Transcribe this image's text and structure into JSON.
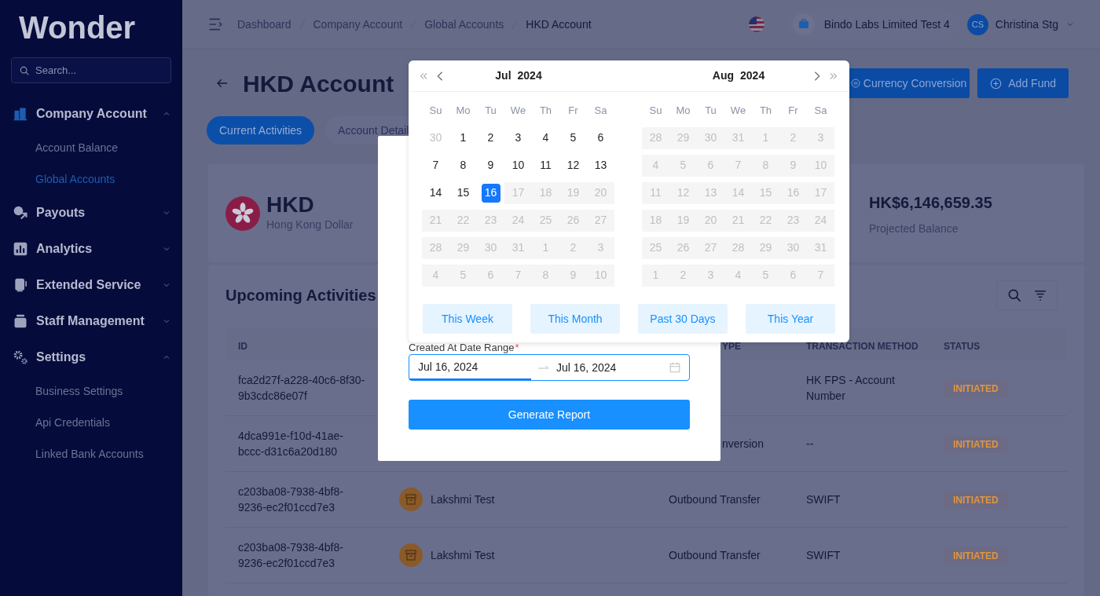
{
  "sidebar": {
    "logo": "Wonder",
    "search_placeholder": "Search...",
    "items": [
      {
        "label": "Company Account",
        "kind": "building",
        "expanded": true,
        "children": [
          {
            "label": "Account Balance",
            "selected": false
          },
          {
            "label": "Global Accounts",
            "selected": true
          }
        ]
      },
      {
        "label": "Payouts",
        "kind": "payout",
        "expanded": false
      },
      {
        "label": "Analytics",
        "kind": "chart",
        "expanded": false
      },
      {
        "label": "Extended Service",
        "kind": "service",
        "expanded": false
      },
      {
        "label": "Staff Management",
        "kind": "staff",
        "expanded": false
      },
      {
        "label": "Settings",
        "kind": "gear",
        "expanded": true,
        "children": [
          {
            "label": "Business Settings",
            "selected": false
          },
          {
            "label": "Api Credentials",
            "selected": false
          },
          {
            "label": "Linked Bank Accounts",
            "selected": false
          }
        ]
      }
    ]
  },
  "header": {
    "breadcrumbs": [
      {
        "label": "Dashboard",
        "selected": false
      },
      {
        "label": "Company Account",
        "selected": false
      },
      {
        "label": "Global Accounts",
        "selected": false
      },
      {
        "label": "HKD Account",
        "selected": true
      }
    ],
    "company": "Bindo Labs Limited Test 4",
    "user_initials": "CS",
    "user_name": "Christina Stg"
  },
  "page": {
    "title": "HKD Account",
    "actions": [
      {
        "label": "Currency Conversion",
        "kind": "convert"
      },
      {
        "label": "Add Fund",
        "kind": "add"
      }
    ],
    "tabs": [
      {
        "label": "Current Activities",
        "selected": true
      },
      {
        "label": "Account Detail",
        "selected": false
      }
    ]
  },
  "balance": {
    "code": "HKD",
    "name": "Hong Kong Dollar",
    "projected": "HK$6,146,659.35",
    "projected_label": "Projected Balance"
  },
  "activities": {
    "title": "Upcoming Activities",
    "columns": [
      {
        "label": "ID",
        "kind": "id",
        "partly_hidden": false
      },
      {
        "label": "YPE",
        "kind": "type",
        "partly_hidden": true
      },
      {
        "label": "TRANSACTION METHOD",
        "kind": "method",
        "partly_hidden": false
      },
      {
        "label": "STATUS",
        "kind": "status",
        "partly_hidden": false
      }
    ],
    "rows": [
      {
        "id": "fca2d27f-a228-40c6-8f30-9b3cdc86e07f",
        "method": "HK FPS - Account Number",
        "status": "INITIATED"
      },
      {
        "id": "4dca991e-f10d-41ae-bccc-d31c6a20d180",
        "type": "nversion",
        "type_partly_hidden": true,
        "method": "--",
        "status": "INITIATED"
      },
      {
        "id": "c203ba08-7938-4bf8-9236-ec2f01ccd7e3",
        "counterparty": "Lakshmi Test",
        "type": "Outbound Transfer",
        "type_partly_hidden": false,
        "method": "SWIFT",
        "status": "INITIATED"
      },
      {
        "id": "c203ba08-7938-4bf8-9236-ec2f01ccd7e3",
        "counterparty": "Lakshmi Test",
        "type": "Outbound Transfer",
        "type_partly_hidden": false,
        "method": "SWIFT",
        "status": "INITIATED"
      }
    ]
  },
  "report_modal": {
    "label": "Created At Date Range",
    "required_mark": "*",
    "start": "Jul 16, 2024",
    "start_active": true,
    "end": "Jul 16, 2024",
    "end_active": false,
    "button": "Generate Report"
  },
  "calendar": {
    "months": [
      {
        "month": "Jul",
        "year": "2024",
        "weekdays": [
          "Su",
          "Mo",
          "Tu",
          "We",
          "Th",
          "Fr",
          "Sa"
        ],
        "weeks": [
          [
            {
              "d": "30",
              "kind": "outside",
              "selected": false
            },
            {
              "d": "1",
              "kind": "available",
              "selected": false
            },
            {
              "d": "2",
              "kind": "available",
              "selected": false
            },
            {
              "d": "3",
              "kind": "available",
              "selected": false
            },
            {
              "d": "4",
              "kind": "available",
              "selected": false
            },
            {
              "d": "5",
              "kind": "available",
              "selected": false
            },
            {
              "d": "6",
              "kind": "available",
              "selected": false
            }
          ],
          [
            {
              "d": "7",
              "kind": "available",
              "selected": false
            },
            {
              "d": "8",
              "kind": "available",
              "selected": false
            },
            {
              "d": "9",
              "kind": "available",
              "selected": false
            },
            {
              "d": "10",
              "kind": "available",
              "selected": false
            },
            {
              "d": "11",
              "kind": "available",
              "selected": false
            },
            {
              "d": "12",
              "kind": "available",
              "selected": false
            },
            {
              "d": "13",
              "kind": "available",
              "selected": false
            }
          ],
          [
            {
              "d": "14",
              "kind": "available",
              "selected": false
            },
            {
              "d": "15",
              "kind": "available",
              "selected": false
            },
            {
              "d": "16",
              "kind": "available",
              "selected": true
            },
            {
              "d": "17",
              "kind": "disabled",
              "selected": false
            },
            {
              "d": "18",
              "kind": "disabled",
              "selected": false
            },
            {
              "d": "19",
              "kind": "disabled",
              "selected": false
            },
            {
              "d": "20",
              "kind": "disabled",
              "selected": false
            }
          ],
          [
            {
              "d": "21",
              "kind": "disabled",
              "selected": false
            },
            {
              "d": "22",
              "kind": "disabled",
              "selected": false
            },
            {
              "d": "23",
              "kind": "disabled",
              "selected": false
            },
            {
              "d": "24",
              "kind": "disabled",
              "selected": false
            },
            {
              "d": "25",
              "kind": "disabled",
              "selected": false
            },
            {
              "d": "26",
              "kind": "disabled",
              "selected": false
            },
            {
              "d": "27",
              "kind": "disabled",
              "selected": false
            }
          ],
          [
            {
              "d": "28",
              "kind": "disabled",
              "selected": false
            },
            {
              "d": "29",
              "kind": "disabled",
              "selected": false
            },
            {
              "d": "30",
              "kind": "disabled",
              "selected": false
            },
            {
              "d": "31",
              "kind": "disabled",
              "selected": false
            },
            {
              "d": "1",
              "kind": "disabled",
              "selected": false
            },
            {
              "d": "2",
              "kind": "disabled",
              "selected": false
            },
            {
              "d": "3",
              "kind": "disabled",
              "selected": false
            }
          ],
          [
            {
              "d": "4",
              "kind": "disabled",
              "selected": false
            },
            {
              "d": "5",
              "kind": "disabled",
              "selected": false
            },
            {
              "d": "6",
              "kind": "disabled",
              "selected": false
            },
            {
              "d": "7",
              "kind": "disabled",
              "selected": false
            },
            {
              "d": "8",
              "kind": "disabled",
              "selected": false
            },
            {
              "d": "9",
              "kind": "disabled",
              "selected": false
            },
            {
              "d": "10",
              "kind": "disabled",
              "selected": false
            }
          ]
        ]
      },
      {
        "month": "Aug",
        "year": "2024",
        "weekdays": [
          "Su",
          "Mo",
          "Tu",
          "We",
          "Th",
          "Fr",
          "Sa"
        ],
        "weeks": [
          [
            {
              "d": "28",
              "kind": "disabled",
              "selected": false
            },
            {
              "d": "29",
              "kind": "disabled",
              "selected": false
            },
            {
              "d": "30",
              "kind": "disabled",
              "selected": false
            },
            {
              "d": "31",
              "kind": "disabled",
              "selected": false
            },
            {
              "d": "1",
              "kind": "disabled",
              "selected": false
            },
            {
              "d": "2",
              "kind": "disabled",
              "selected": false
            },
            {
              "d": "3",
              "kind": "disabled",
              "selected": false
            }
          ],
          [
            {
              "d": "4",
              "kind": "disabled",
              "selected": false
            },
            {
              "d": "5",
              "kind": "disabled",
              "selected": false
            },
            {
              "d": "6",
              "kind": "disabled",
              "selected": false
            },
            {
              "d": "7",
              "kind": "disabled",
              "selected": false
            },
            {
              "d": "8",
              "kind": "disabled",
              "selected": false
            },
            {
              "d": "9",
              "kind": "disabled",
              "selected": false
            },
            {
              "d": "10",
              "kind": "disabled",
              "selected": false
            }
          ],
          [
            {
              "d": "11",
              "kind": "disabled",
              "selected": false
            },
            {
              "d": "12",
              "kind": "disabled",
              "selected": false
            },
            {
              "d": "13",
              "kind": "disabled",
              "selected": false
            },
            {
              "d": "14",
              "kind": "disabled",
              "selected": false
            },
            {
              "d": "15",
              "kind": "disabled",
              "selected": false
            },
            {
              "d": "16",
              "kind": "disabled",
              "selected": false
            },
            {
              "d": "17",
              "kind": "disabled",
              "selected": false
            }
          ],
          [
            {
              "d": "18",
              "kind": "disabled",
              "selected": false
            },
            {
              "d": "19",
              "kind": "disabled",
              "selected": false
            },
            {
              "d": "20",
              "kind": "disabled",
              "selected": false
            },
            {
              "d": "21",
              "kind": "disabled",
              "selected": false
            },
            {
              "d": "22",
              "kind": "disabled",
              "selected": false
            },
            {
              "d": "23",
              "kind": "disabled",
              "selected": false
            },
            {
              "d": "24",
              "kind": "disabled",
              "selected": false
            }
          ],
          [
            {
              "d": "25",
              "kind": "disabled",
              "selected": false
            },
            {
              "d": "26",
              "kind": "disabled",
              "selected": false
            },
            {
              "d": "27",
              "kind": "disabled",
              "selected": false
            },
            {
              "d": "28",
              "kind": "disabled",
              "selected": false
            },
            {
              "d": "29",
              "kind": "disabled",
              "selected": false
            },
            {
              "d": "30",
              "kind": "disabled",
              "selected": false
            },
            {
              "d": "31",
              "kind": "disabled",
              "selected": false
            }
          ],
          [
            {
              "d": "1",
              "kind": "disabled",
              "selected": false
            },
            {
              "d": "2",
              "kind": "disabled",
              "selected": false
            },
            {
              "d": "3",
              "kind": "disabled",
              "selected": false
            },
            {
              "d": "4",
              "kind": "disabled",
              "selected": false
            },
            {
              "d": "5",
              "kind": "disabled",
              "selected": false
            },
            {
              "d": "6",
              "kind": "disabled",
              "selected": false
            },
            {
              "d": "7",
              "kind": "disabled",
              "selected": false
            }
          ]
        ]
      }
    ],
    "shortcuts": [
      "This Week",
      "This Month",
      "Past 30 Days",
      "This Year"
    ]
  }
}
